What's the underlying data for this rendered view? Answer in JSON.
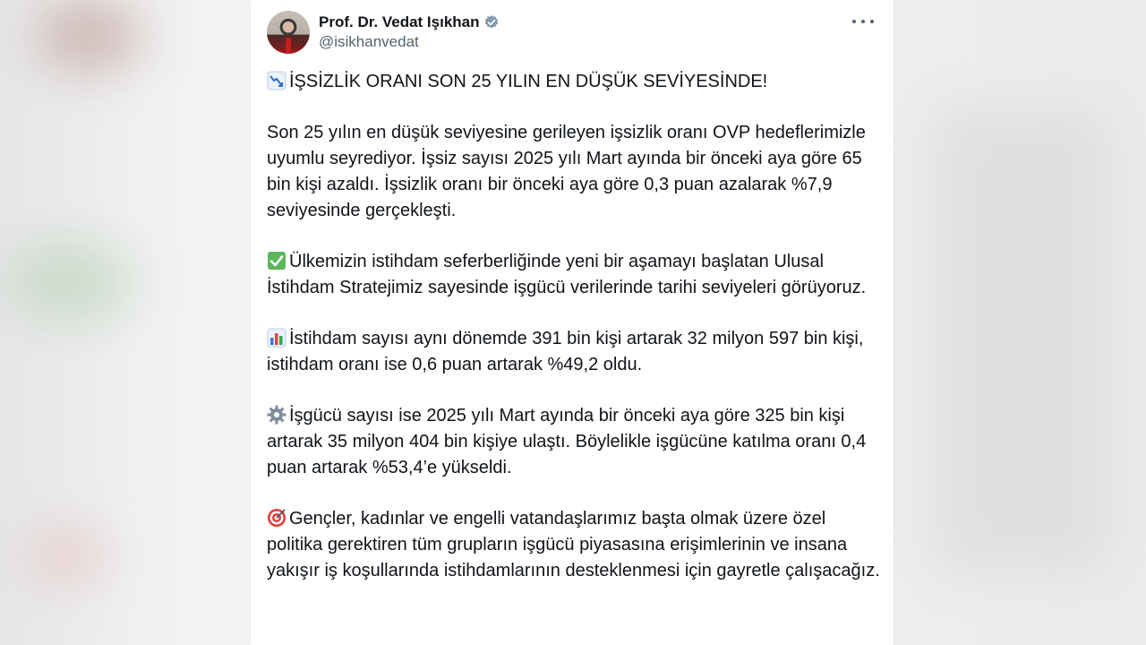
{
  "author": {
    "display_name": "Prof. Dr. Vedat Işıkhan",
    "handle": "@isikhanvedat",
    "verified": true
  },
  "icons": {
    "avatar": "profile-photo",
    "verified": "verified-badge-icon",
    "more": "more-options-icon"
  },
  "tweet": {
    "headline": "İŞSİZLİK ORANI SON 25 YILIN EN DÜŞÜK SEVİYESİNDE!",
    "p1": "Son 25 yılın en düşük seviyesine gerileyen işsizlik oranı OVP hedeflerimizle uyumlu seyrediyor. İşsiz sayısı 2025 yılı Mart ayında bir önceki aya göre 65 bin kişi azaldı. İşsizlik oranı bir önceki aya göre 0,3 puan azalarak %7,9 seviyesinde gerçekleşti.",
    "p2": "Ülkemizin istihdam seferberliğinde yeni bir aşamayı başlatan Ulusal İstihdam Stratejimiz sayesinde işgücü verilerinde tarihi seviyeleri görüyoruz.",
    "p3": "İstihdam sayısı aynı dönemde 391 bin kişi artarak 32 milyon 597 bin kişi, istihdam oranı ise 0,6 puan artarak %49,2 oldu.",
    "p4": "İşgücü sayısı ise 2025 yılı Mart ayında bir önceki aya göre 325 bin kişi artarak 35 milyon 404 bin kişiye ulaştı. Böylelikle işgücüne katılma oranı 0,4 puan artarak %53,4’e yükseldi.",
    "p5": "Gençler, kadınlar ve engelli vatandaşlarımız başta olmak üzere özel politika gerektiren tüm grupların işgücü piyasasına erişimlerinin ve insana yakışır iş koşullarında istihdamlarının desteklenmesi için gayretle çalışacağız."
  },
  "emoji_icons": [
    "chart-decreasing-icon",
    "check-mark-icon",
    "bar-chart-icon",
    "gear-icon",
    "target-icon"
  ]
}
